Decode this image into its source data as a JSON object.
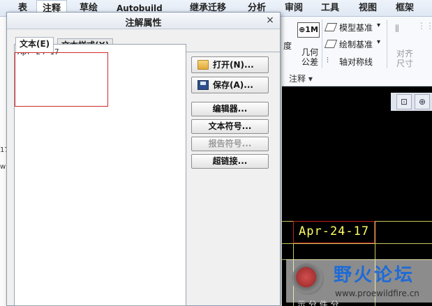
{
  "ribbon": {
    "tabs": [
      "表",
      "注释",
      "草绘",
      "Autobuild",
      "继承迁移",
      "分析",
      "审阅",
      "工具",
      "视图",
      "框架"
    ],
    "active_tab": "注释",
    "items": {
      "degree_label": "度",
      "geo_tol_top": "几何",
      "geo_tol_bottom": "公差",
      "model_datum": "模型基准",
      "sketch_datum": "绘制基准",
      "axis_symmetry": "轴对称线",
      "align_top": "对齐",
      "align_bottom": "尺寸"
    },
    "group_label": "注释",
    "group_arrow": "▾",
    "dropdown_arrow": "▾"
  },
  "left_fragments": [
    "17",
    "w"
  ],
  "dialog": {
    "title": "注解属性",
    "close_glyph": "×",
    "tabs": [
      {
        "label": "文本(E)",
        "active": true
      },
      {
        "label": "文本样式(X)",
        "active": false
      }
    ],
    "text_value": "Apr-24-17",
    "buttons": {
      "open": "打开(N)...",
      "save": "保存(A)...",
      "editor": "编辑器...",
      "text_symbol": "文本符号...",
      "report_symbol": "报告符号...",
      "hyperlink": "超链接..."
    }
  },
  "canvas": {
    "annotation_text": "Apr-24-17",
    "zoom_fit_glyph": "⊡",
    "zoom_in_glyph": "⊕",
    "bottom_fragment": "示 分 件 分 ..."
  },
  "watermark": {
    "title": "野火论坛",
    "url": "www.proewildfire.cn"
  },
  "colors": {
    "annotation_text": "#ffff66",
    "highlight_border": "#d02828",
    "watermark_title": "#1e6bd6",
    "canvas_bg": "#000000"
  }
}
